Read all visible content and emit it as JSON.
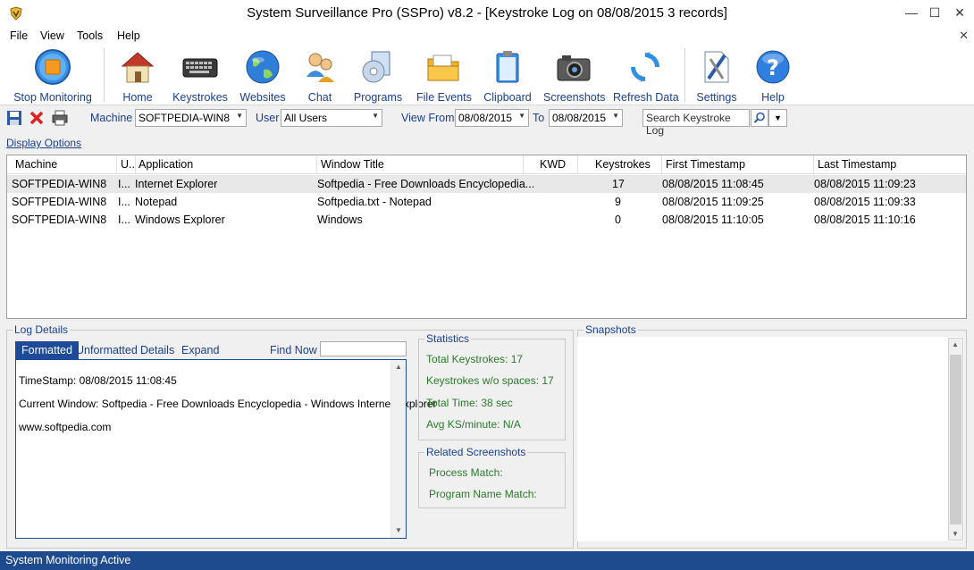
{
  "window": {
    "title": "System Surveillance Pro (SSPro) v8.2 - [Keystroke Log on 08/08/2015  3 records]",
    "minimize_glyph": "—",
    "maximize_glyph": "☐",
    "close_glyph": "✕"
  },
  "menu": {
    "items": [
      "File",
      "View",
      "Tools",
      "Help"
    ],
    "close_glyph": "✕"
  },
  "toolbar": {
    "buttons": [
      {
        "label": "Stop Monitoring",
        "icon": "stop-icon"
      },
      {
        "label": "Home",
        "icon": "home-icon"
      },
      {
        "label": "Keystrokes",
        "icon": "keyboard-icon"
      },
      {
        "label": "Websites",
        "icon": "globe-icon"
      },
      {
        "label": "Chat",
        "icon": "chat-icon"
      },
      {
        "label": "Programs",
        "icon": "programs-icon"
      },
      {
        "label": "File Events",
        "icon": "folder-icon"
      },
      {
        "label": "Clipboard",
        "icon": "clipboard-icon"
      },
      {
        "label": "Screenshots",
        "icon": "camera-icon"
      },
      {
        "label": "Refresh Data",
        "icon": "refresh-icon"
      },
      {
        "label": "Settings",
        "icon": "settings-icon"
      },
      {
        "label": "Help",
        "icon": "help-icon"
      }
    ]
  },
  "filters": {
    "machine_label": "Machine",
    "machine_value": "SOFTPEDIA-WIN8",
    "user_label": "User",
    "user_value": "All Users",
    "view_from_label": "View From",
    "view_from_value": "08/08/2015",
    "to_label": "To",
    "to_value": "08/08/2015",
    "search_placeholder": "Search Keystroke Log"
  },
  "display_options": "Display Options",
  "grid": {
    "columns": [
      "Machine",
      "U..",
      "Application",
      "Window Title",
      "KWD",
      "Keystrokes",
      "First Timestamp",
      "Last Timestamp"
    ],
    "rows": [
      {
        "machine": "SOFTPEDIA-WIN8",
        "user": "I...",
        "application": "Internet Explorer",
        "window_title": "Softpedia - Free Downloads Encyclopedia...",
        "kwd": "",
        "keystrokes": "17",
        "first": "08/08/2015 11:08:45",
        "last": "08/08/2015 11:09:23"
      },
      {
        "machine": "SOFTPEDIA-WIN8",
        "user": "I...",
        "application": "Notepad",
        "window_title": "Softpedia.txt - Notepad",
        "kwd": "",
        "keystrokes": "9",
        "first": "08/08/2015 11:09:25",
        "last": "08/08/2015 11:09:33"
      },
      {
        "machine": "SOFTPEDIA-WIN8",
        "user": "I...",
        "application": "Windows Explorer",
        "window_title": "Windows",
        "kwd": "",
        "keystrokes": "0",
        "first": "08/08/2015 11:10:05",
        "last": "08/08/2015 11:10:16"
      }
    ]
  },
  "log_details": {
    "title": "Log Details",
    "tabs": [
      "Formatted",
      "Unformatted",
      "Details",
      "Expand"
    ],
    "find_now": "Find Now",
    "lines": [
      "TimeStamp: 08/08/2015 11:08:45",
      "Current Window: Softpedia - Free Downloads Encyclopedia - Windows Internet Explorer",
      "www.softpedia.com"
    ]
  },
  "statistics": {
    "title": "Statistics",
    "lines": [
      "Total Keystrokes: 17",
      "Keystrokes w/o spaces: 17",
      "Total Time: 38 sec",
      "Avg KS/minute: N/A"
    ]
  },
  "related": {
    "title": "Related Screenshots",
    "lines": [
      "Process Match:",
      "Program Name Match:"
    ]
  },
  "snapshots": {
    "title": "Snapshots"
  },
  "status": "System Monitoring Active"
}
